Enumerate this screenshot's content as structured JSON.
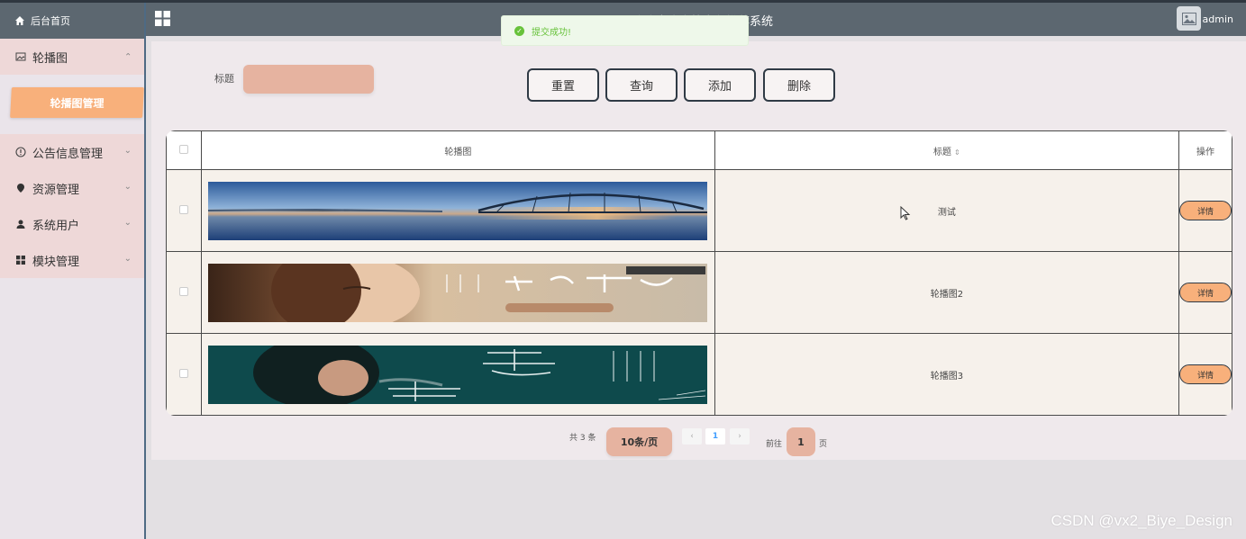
{
  "sidebar": {
    "home_label": "后台首页",
    "items": [
      {
        "label": "轮播图",
        "icon": "image-icon",
        "expanded": true,
        "sub": "轮播图管理"
      },
      {
        "label": "公告信息管理",
        "icon": "info-circle-icon"
      },
      {
        "label": "资源管理",
        "icon": "location-pin-icon"
      },
      {
        "label": "系统用户",
        "icon": "user-icon"
      },
      {
        "label": "模块管理",
        "icon": "grid-icon"
      }
    ]
  },
  "header": {
    "title": "欢迎光临高校文化推荐系统",
    "user": "admin"
  },
  "toast": {
    "message": "提交成功!"
  },
  "search": {
    "label": "标题",
    "value": ""
  },
  "buttons": {
    "reset": "重置",
    "query": "查询",
    "add": "添加",
    "delete": "删除"
  },
  "table": {
    "headers": {
      "image": "轮播图",
      "title": "标题",
      "action": "操作"
    },
    "rows": [
      {
        "title": "测试",
        "image": "bridge-sunset-banner",
        "action": "详情"
      },
      {
        "title": "轮播图2",
        "image": "woman-album-banner",
        "action": "详情"
      },
      {
        "title": "轮播图3",
        "image": "teal-album-banner",
        "action": "详情"
      }
    ]
  },
  "pagination": {
    "total": "共 3 条",
    "page_size": "10条/页",
    "prev": "‹",
    "current": "1",
    "next": "›",
    "goto_label": "前往",
    "goto_value": "1",
    "page_unit": "页"
  },
  "watermark": "CSDN @vx2_Biye_Design",
  "colors": {
    "header_bg": "#5c6770",
    "accent": "#f8b07b",
    "input_bg": "#e6b3a0",
    "menu_bg": "#eed8d8",
    "toast_green": "#67c23a"
  }
}
